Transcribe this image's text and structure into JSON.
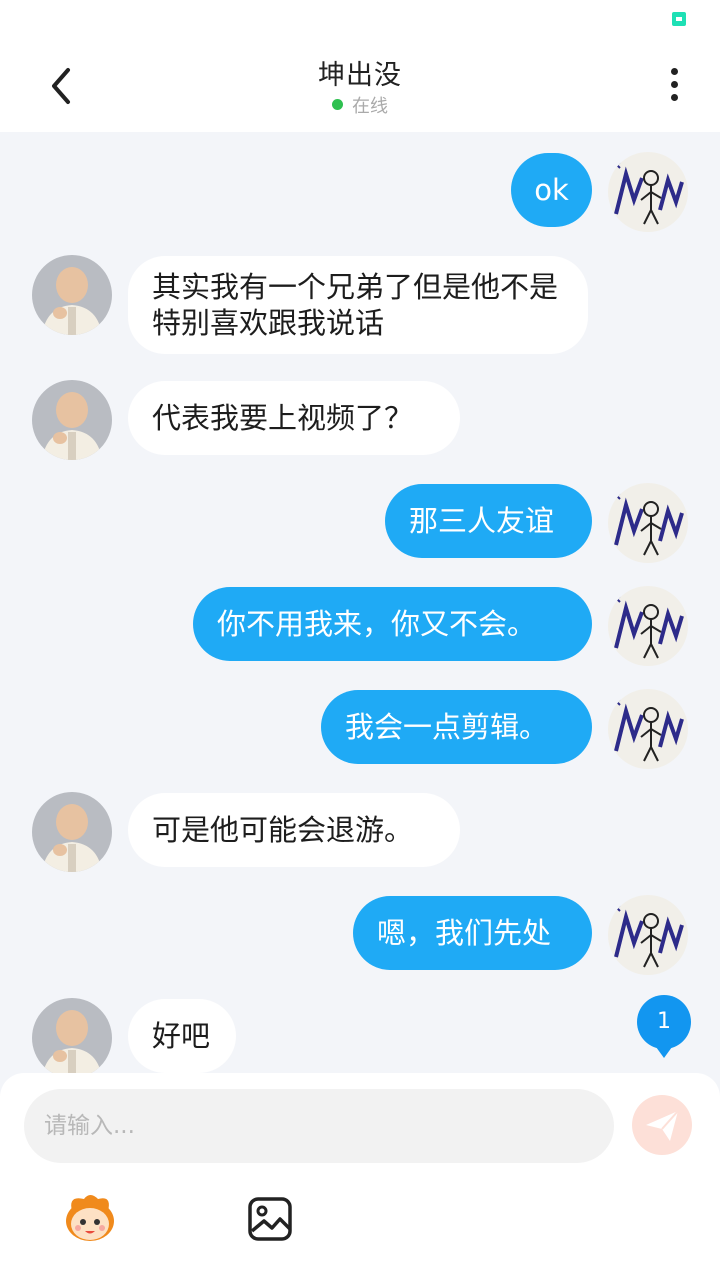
{
  "header": {
    "title": "坤出没",
    "status": "在线"
  },
  "messages": [
    {
      "direction": "out",
      "text": "ok"
    },
    {
      "direction": "in",
      "text": "其实我有一个兄弟了但是他不是特别喜欢跟我说话"
    },
    {
      "direction": "in",
      "text": "代表我要上视频了？"
    },
    {
      "direction": "out",
      "text": "那三人友谊"
    },
    {
      "direction": "out",
      "text": "你不用我来，你又不会。"
    },
    {
      "direction": "out",
      "text": "我会一点剪辑。"
    },
    {
      "direction": "in",
      "text": "可是他可能会退游。"
    },
    {
      "direction": "out",
      "text": "嗯，我们先处"
    },
    {
      "direction": "in",
      "text": "好吧"
    }
  ],
  "unread_count": "1",
  "composer": {
    "placeholder": "请输入..."
  },
  "icons": {
    "back": "chevron-left-icon",
    "more": "more-vertical-icon",
    "send": "paper-plane-icon",
    "emoji": "mascot-emoji-icon",
    "image": "image-icon",
    "status": "app-status-icon"
  },
  "colors": {
    "outgoing_bubble": "#1faaf5",
    "incoming_bubble": "#ffffff",
    "background": "#f3f5f9",
    "online_dot": "#2ec050",
    "badge": "#1296f0",
    "send_button": "#fde0d8"
  }
}
